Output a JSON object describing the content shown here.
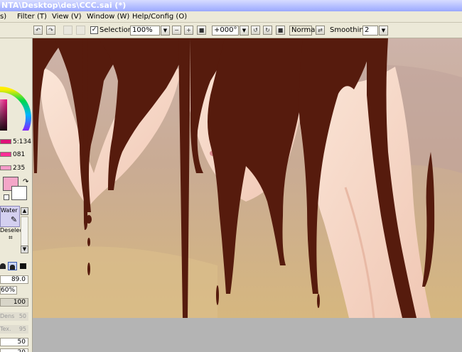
{
  "window": {
    "title": "NTA\\Desktop\\des\\CCC.sai (*)"
  },
  "menu": {
    "items": [
      {
        "label": "s)"
      },
      {
        "label": "Filter (T)"
      },
      {
        "label": "View (V)"
      },
      {
        "label": "Window (W)"
      },
      {
        "label": "Help/Config (O)"
      }
    ]
  },
  "toolbar": {
    "selection_label": "Selection",
    "selection_checked": "✓",
    "zoom_value": "100%",
    "rotation_value": "+000°",
    "blend_mode": "Normal",
    "smoothing_label": "Smoothing",
    "smoothing_value": "2"
  },
  "left_panel": {
    "color_values": [
      "5:134",
      "081",
      "235"
    ],
    "swatch_color": "#f4a6c8",
    "tool_water_label": "Water",
    "tool_deselect_label": "Deselect",
    "brush_size": "89.0",
    "brush_scale": "60%",
    "min_size": "100",
    "density_label": "Dens",
    "density_value": "50",
    "texture_label": "Tex.",
    "texture_value": "95",
    "extra_values": [
      "50",
      "20"
    ]
  },
  "colors": {
    "accent_magenta": "#e0127a",
    "chrome": "#ece9d8",
    "hair": "#561b0d"
  },
  "icons": {
    "swap_colors": "arrow-swap-icon",
    "brush_water": "water-brush-icon",
    "deselect": "deselect-icon"
  }
}
